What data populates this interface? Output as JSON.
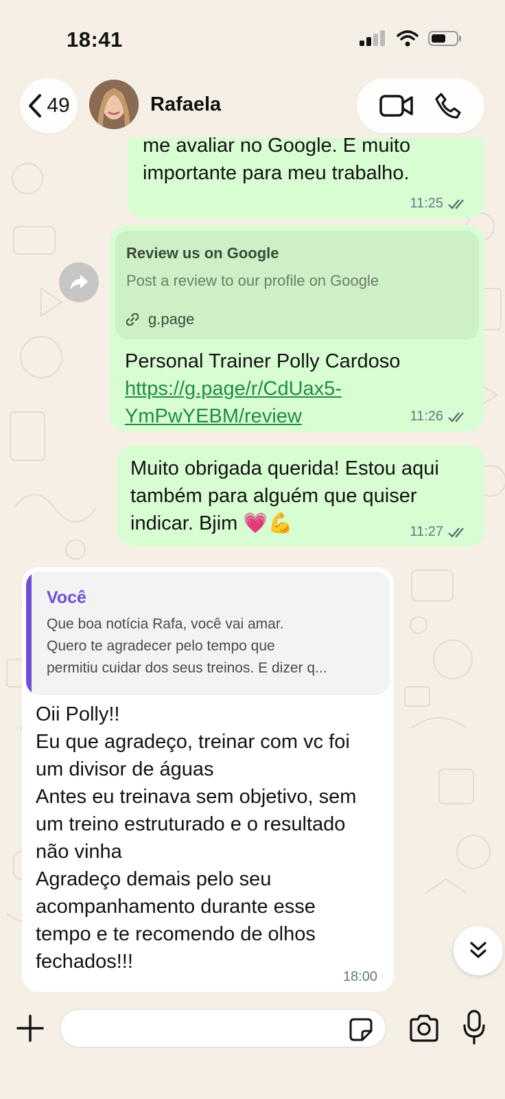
{
  "status_bar": {
    "time": "18:41"
  },
  "header": {
    "back_count": "49",
    "contact_name": "Rafaela"
  },
  "messages": {
    "m1": {
      "line1": "me avaliar no Google. É muito",
      "line2": "importante para meu trabalho.",
      "time": "11:25"
    },
    "m2": {
      "preview_title": "Review us on Google",
      "preview_desc": "Post a review to our profile on Google",
      "preview_domain": "g.page",
      "text": "Personal Trainer Polly Cardoso",
      "link_line1": "https://g.page/r/CdUax5-",
      "link_line2": "YmPwYEBM/review",
      "time": "11:26"
    },
    "m3": {
      "line1": "Muito obrigada querida! Estou aqui",
      "line2": "também para alguém que quiser",
      "line3": "indicar. Bjim 💗💪",
      "time": "11:27"
    },
    "m4": {
      "quote_author": "Você",
      "quote_line1": "Que boa notícia Rafa, você vai amar.",
      "quote_line2": "Quero te agradecer pelo tempo que",
      "quote_line3": "permitiu cuidar dos seus treinos. E dizer q...",
      "lines": [
        "Oii Polly!!",
        "Eu que agradeço, treinar com vc foi",
        "um divisor de águas",
        "Antes eu treinava sem objetivo, sem",
        "um treino estruturado e o resultado",
        "não vinha",
        "Agradeço demais pelo seu",
        "acompanhamento durante esse",
        "tempo e te recomendo de olhos",
        "fechados!!!"
      ],
      "time": "18:00"
    }
  },
  "composer": {
    "placeholder": ""
  },
  "colors": {
    "outgoing_bubble": "#d9fdd3",
    "incoming_bubble": "#ffffff",
    "link": "#1f8a4c",
    "quote_accent": "#6e4fd8",
    "read_ticks": "#53686f"
  }
}
